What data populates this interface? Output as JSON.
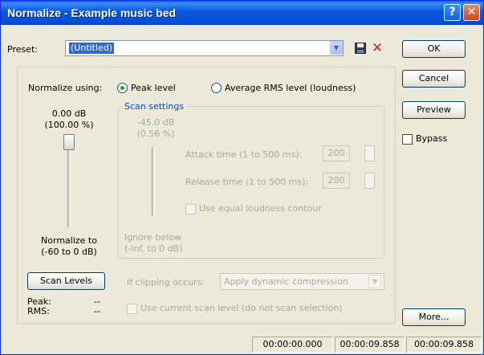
{
  "window": {
    "title": "Normalize - Example music bed",
    "help_glyph": "?",
    "close_glyph": "✕"
  },
  "preset": {
    "label": "Preset:",
    "value": "(Untitled)",
    "save_icon": "floppy-disk-icon",
    "delete_icon": "red-x-icon",
    "delete_glyph": "✕"
  },
  "buttons": {
    "ok": "OK",
    "cancel": "Cancel",
    "preview": "Preview",
    "more": "More...",
    "scan_levels": "Scan Levels"
  },
  "bypass": {
    "label": "Bypass",
    "checked": false
  },
  "normalize": {
    "label": "Normalize using:",
    "option_peak": "Peak level",
    "option_rms": "Average RMS level (loudness)",
    "selected": "Peak level",
    "level_db": "0.00 dB",
    "level_pct": "(100.00 %)",
    "range_label_1": "Normalize to",
    "range_label_2": "(-60 to 0 dB)"
  },
  "scan": {
    "title": "Scan settings",
    "level_db": "-45.0 dB",
    "level_pct": "(0.56 %)",
    "attack_label": "Attack time (1 to 500 ms):",
    "attack_value": "200",
    "release_label": "Release time (1 to 500 ms):",
    "release_value": "200",
    "equal_loudness_label": "Use equal loudness contour",
    "ignore_label_1": "Ignore below",
    "ignore_label_2": "(-Inf. to 0 dB)"
  },
  "clipping": {
    "label": "If clipping occurs:",
    "value": "Apply dynamic compression"
  },
  "readout": {
    "peak_label": "Peak:",
    "peak_value": "--",
    "rms_label": "RMS:",
    "rms_value": "--"
  },
  "use_current_scan": {
    "label": "Use current scan level (do not scan selection)"
  },
  "status": {
    "t1": "00:00:00.000",
    "t2": "00:00:09.858",
    "t3": "00:00:09.858"
  }
}
